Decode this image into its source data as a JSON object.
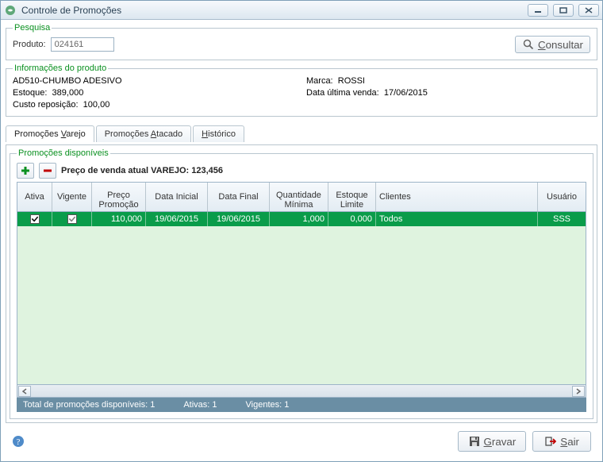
{
  "window": {
    "title": "Controle de Promoções"
  },
  "search": {
    "legend": "Pesquisa",
    "product_label": "Produto:",
    "product_value": "024161",
    "consult_btn": "onsultar",
    "consult_u": "C"
  },
  "info": {
    "legend": "Informações do produto",
    "name": "AD510-CHUMBO ADESIVO",
    "stock_label": "Estoque:",
    "stock_value": "389,000",
    "cost_label": "Custo reposição:",
    "cost_value": "100,00",
    "brand_label": "Marca:",
    "brand_value": "ROSSI",
    "lastsale_label": "Data última venda:",
    "lastsale_value": "17/06/2015"
  },
  "tabs": {
    "retail_pre": "Promoções ",
    "retail_u": "V",
    "retail_post": "arejo",
    "wholesale_pre": "Promoções ",
    "wholesale_u": "A",
    "wholesale_post": "tacado",
    "history_pre": "",
    "history_u": "H",
    "history_post": "istórico"
  },
  "promo": {
    "legend": "Promoções disponíveis",
    "price_label": "Preço de venda atual VAREJO:",
    "price_value": "123,456",
    "headers": {
      "ativa": "Ativa",
      "vigente": "Vigente",
      "preco1": "Preço",
      "preco2": "Promoção",
      "data_ini": "Data Inicial",
      "data_fin": "Data Final",
      "qtd1": "Quantidade",
      "qtd2": "Mínima",
      "est1": "Estoque",
      "est2": "Limite",
      "clientes": "Clientes",
      "usuario": "Usuário"
    },
    "rows": [
      {
        "ativa": true,
        "vigente": true,
        "preco": "110,000",
        "data_ini": "19/06/2015",
        "data_fin": "19/06/2015",
        "qtd": "1,000",
        "est": "0,000",
        "clientes": "Todos",
        "usuario": "SSS"
      }
    ],
    "status_total_label": "Total de promoções disponíveis:",
    "status_total_value": "1",
    "status_ativas_label": "Ativas:",
    "status_ativas_value": "1",
    "status_vigentes_label": "Vigentes:",
    "status_vigentes_value": "1"
  },
  "footer": {
    "gravar_u": "G",
    "gravar_post": "ravar",
    "sair_u": "S",
    "sair_post": "air"
  }
}
